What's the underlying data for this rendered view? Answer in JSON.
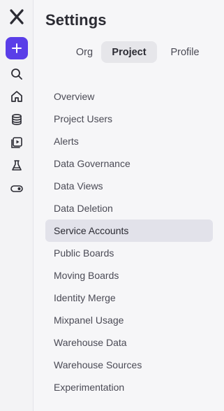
{
  "app": {
    "logo": "mixpanel-x-logo"
  },
  "rail": {
    "add_label": "+",
    "icons": [
      "search-icon",
      "home-icon",
      "database-icon",
      "play-library-icon",
      "flask-icon",
      "toggle-icon"
    ]
  },
  "page": {
    "title": "Settings"
  },
  "tabs": [
    {
      "label": "Org",
      "active": false
    },
    {
      "label": "Project",
      "active": true
    },
    {
      "label": "Profile",
      "active": false
    }
  ],
  "menu": {
    "items": [
      {
        "label": "Overview"
      },
      {
        "label": "Project Users"
      },
      {
        "label": "Alerts"
      },
      {
        "label": "Data Governance"
      },
      {
        "label": "Data Views"
      },
      {
        "label": "Data Deletion"
      },
      {
        "label": "Service Accounts",
        "active": true
      },
      {
        "label": "Public Boards"
      },
      {
        "label": "Moving Boards"
      },
      {
        "label": "Identity Merge"
      },
      {
        "label": "Mixpanel Usage"
      },
      {
        "label": "Warehouse Data"
      },
      {
        "label": "Warehouse Sources"
      },
      {
        "label": "Experimentation"
      }
    ]
  },
  "colors": {
    "accent": "#5a3ee8",
    "active_bg": "#e2e2ea"
  }
}
